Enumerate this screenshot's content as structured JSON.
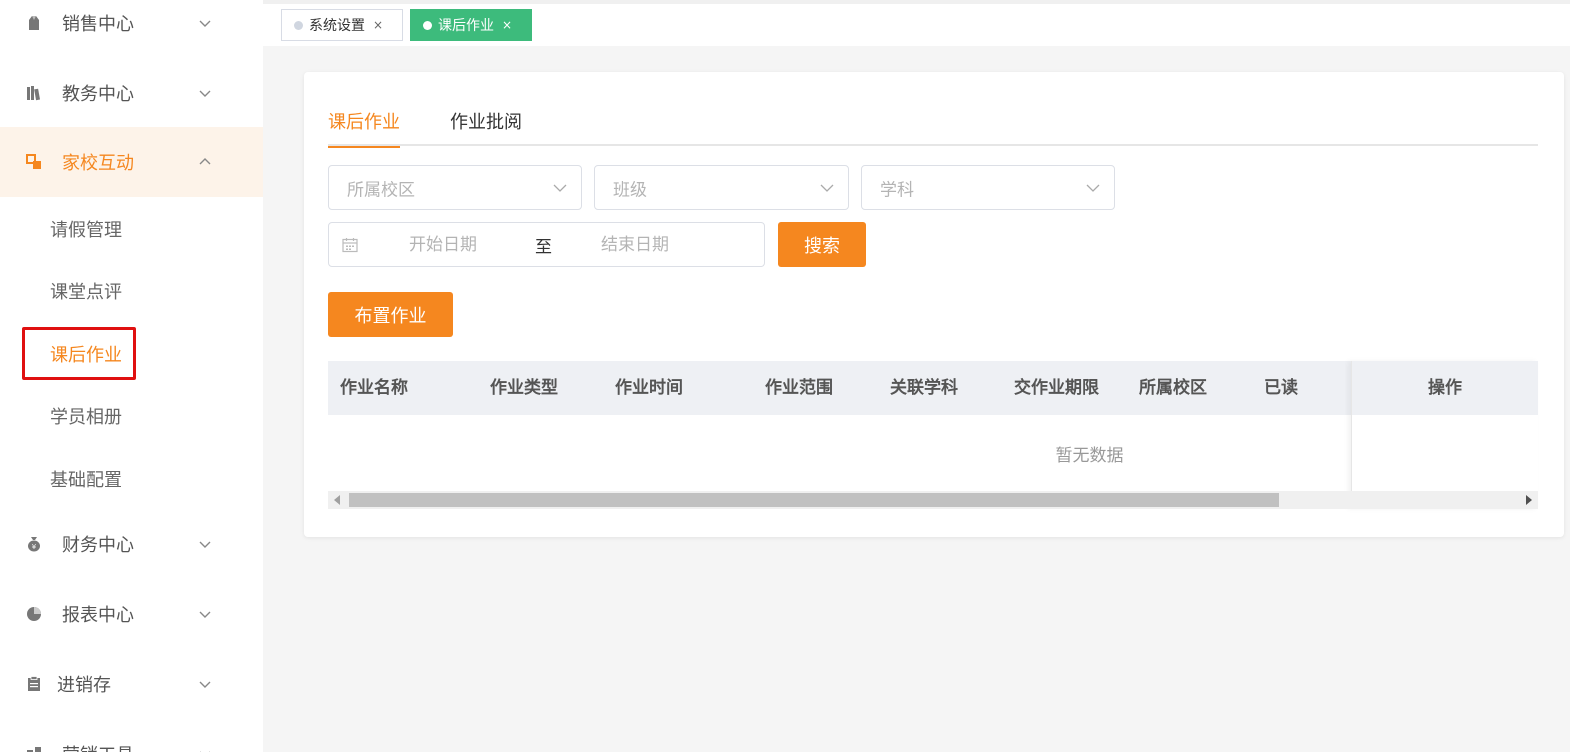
{
  "colors": {
    "accent": "#f5871f",
    "active_tab": "#3dbb7c",
    "highlight": "#e01010"
  },
  "sidebar": {
    "groups": [
      {
        "label": "销售中心",
        "icon": "bag-icon",
        "expanded": false
      },
      {
        "label": "教务中心",
        "icon": "books-icon",
        "expanded": false
      },
      {
        "label": "家校互动",
        "icon": "interaction-icon",
        "expanded": true
      },
      {
        "label": "财务中心",
        "icon": "money-bag-icon",
        "expanded": false
      },
      {
        "label": "报表中心",
        "icon": "pie-chart-icon",
        "expanded": false
      },
      {
        "label": "进销存",
        "icon": "clipboard-icon",
        "expanded": false
      },
      {
        "label": "营销工具",
        "icon": "tool-icon",
        "expanded": false
      }
    ],
    "sub_items": [
      "请假管理",
      "课堂点评",
      "课后作业",
      "学员相册",
      "基础配置"
    ],
    "active_sub": "课后作业"
  },
  "tabbar": {
    "tabs": [
      {
        "label": "系统设置",
        "close": "×",
        "active": false
      },
      {
        "label": "课后作业",
        "close": "×",
        "active": true
      }
    ]
  },
  "content": {
    "tabs": [
      {
        "label": "课后作业",
        "active": true
      },
      {
        "label": "作业批阅",
        "active": false
      }
    ],
    "filters": {
      "campus_placeholder": "所属校区",
      "class_placeholder": "班级",
      "subject_placeholder": "学科",
      "start_placeholder": "开始日期",
      "separator": "至",
      "end_placeholder": "结束日期"
    },
    "search_label": "搜索",
    "assign_label": "布置作业",
    "table": {
      "columns": [
        "作业名称",
        "作业类型",
        "作业时间",
        "作业范围",
        "关联学科",
        "交作业期限",
        "所属校区",
        "已读"
      ],
      "action_column": "操作",
      "empty_text": "暂无数据"
    }
  }
}
